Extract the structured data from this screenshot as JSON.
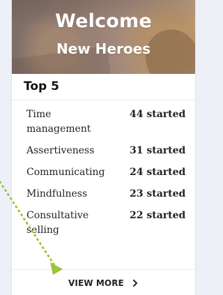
{
  "hero": {
    "title": "Welcome",
    "subtitle": "New Heroes"
  },
  "top5": {
    "title": "Top 5",
    "items": [
      {
        "topic": "Time management",
        "count": "44 started"
      },
      {
        "topic": "Assertiveness",
        "count": "31 started"
      },
      {
        "topic": "Communicating",
        "count": "24 started"
      },
      {
        "topic": "Mindfulness",
        "count": "23 started"
      },
      {
        "topic": "Consultative selling",
        "count": "22 started"
      }
    ]
  },
  "footer": {
    "view_more_label": "VIEW MORE",
    "icon": "chevron-right-icon"
  },
  "colors": {
    "background": "#eef0f8",
    "pointer": "#9bc33c",
    "text": "#222222"
  }
}
